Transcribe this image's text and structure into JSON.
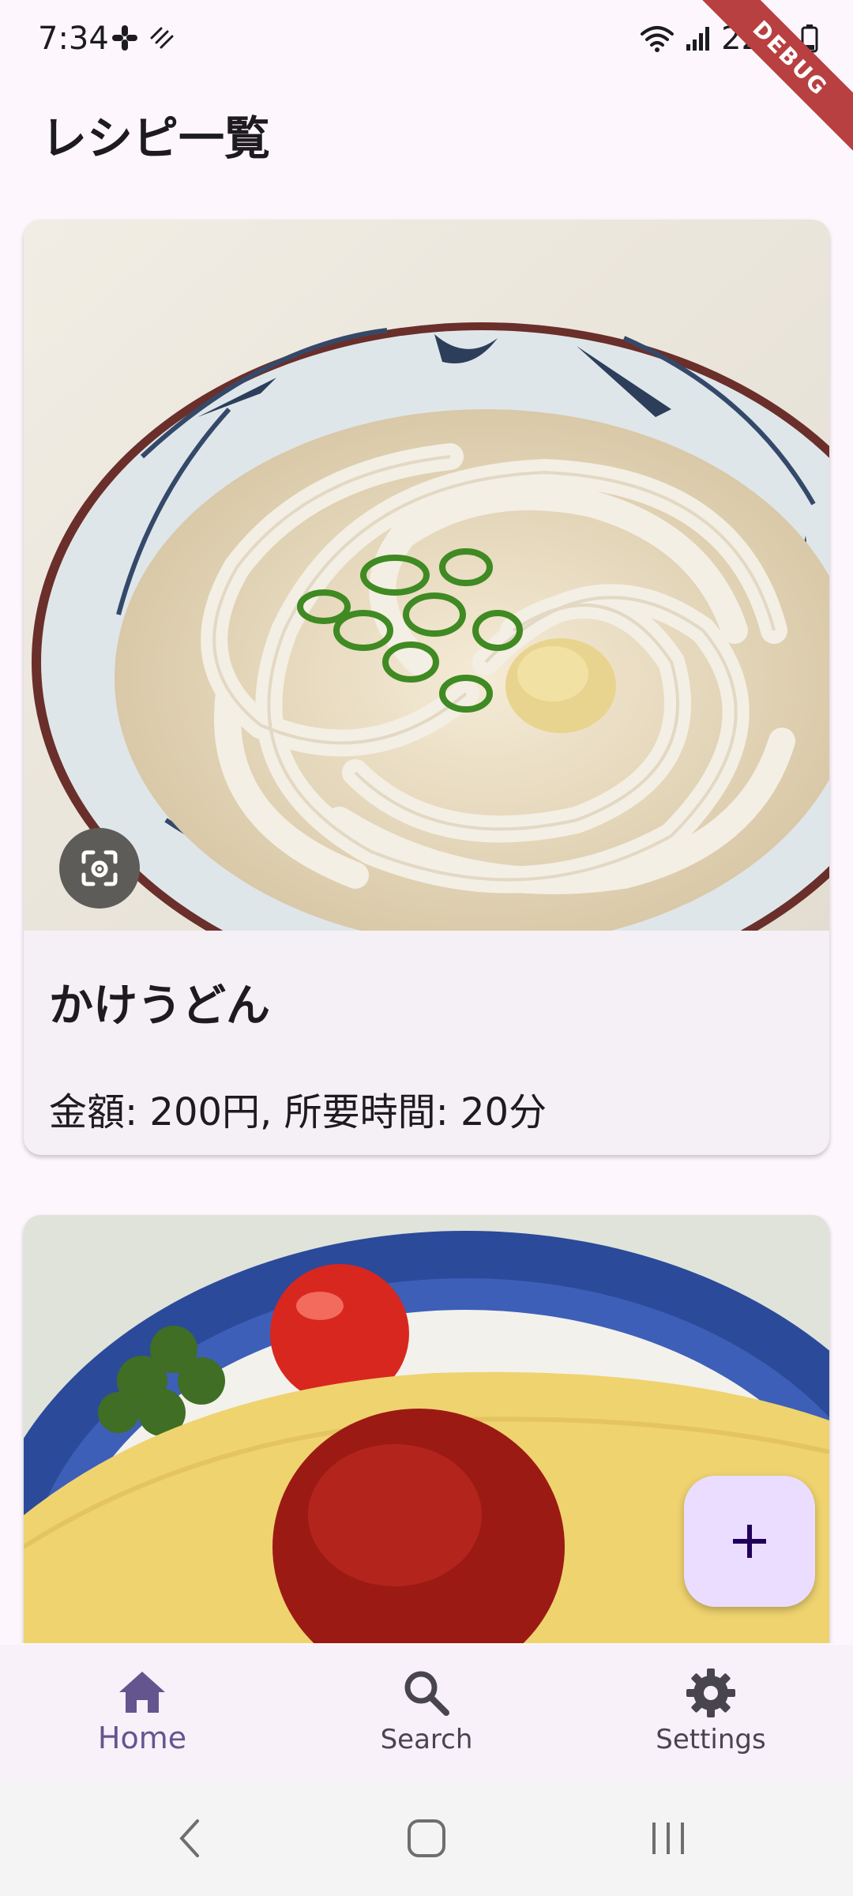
{
  "status_bar": {
    "time": "7:34",
    "battery": "22%",
    "debug_banner": "DEBUG"
  },
  "app_bar": {
    "title": "レシピ一覧"
  },
  "recipes": [
    {
      "name": "かけうどん",
      "detail": "金額: 200円, 所要時間: 20分"
    }
  ],
  "bottom_nav": {
    "items": [
      {
        "label": "Home",
        "icon": "home-icon",
        "active": true
      },
      {
        "label": "Search",
        "icon": "search-icon",
        "active": false
      },
      {
        "label": "Settings",
        "icon": "settings-icon",
        "active": false
      }
    ]
  },
  "colors": {
    "accent": "#65558f",
    "fab_bg": "#eaddff",
    "background": "#fdf7fd"
  }
}
